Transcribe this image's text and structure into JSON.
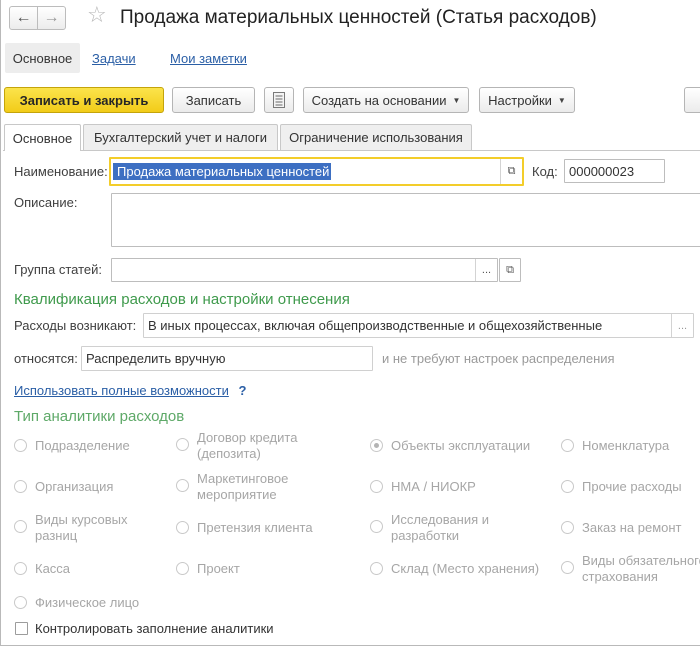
{
  "window": {
    "title": "Продажа материальных ценностей (Статья расходов)"
  },
  "nav": {
    "back_icon": "arrow-left-icon",
    "forward_icon": "arrow-right-icon",
    "favorite_icon": "star-icon",
    "tabs": [
      {
        "label": "Основное",
        "active": true
      },
      {
        "label": "Задачи"
      },
      {
        "label": "Мои заметки"
      }
    ]
  },
  "toolbar": {
    "save_close": "Записать и закрыть",
    "save": "Записать",
    "report_icon": "document-list-icon",
    "create_based": "Создать на основании",
    "settings": "Настройки"
  },
  "content_tabs": [
    {
      "label": "Основное",
      "active": true
    },
    {
      "label": "Бухгалтерский учет и налоги"
    },
    {
      "label": "Ограничение использования"
    }
  ],
  "form": {
    "name_label": "Наименование:",
    "name_value": "Продажа материальных ценностей",
    "code_label": "Код:",
    "code_value": "000000023",
    "description_label": "Описание:",
    "description_value": "",
    "group_label": "Группа статей:",
    "group_value": "",
    "select_button": "...",
    "open_icon": "open-form-icon"
  },
  "qualification": {
    "heading": "Квалификация расходов и настройки отнесения",
    "expenses_arise_label": "Расходы возникают:",
    "expenses_arise_value": "В иных процессах, включая общепроизводственные и общехозяйственные",
    "relates_label": "относятся:",
    "relates_value": "Распределить вручную",
    "relates_hint": "и не требуют настроек распределения",
    "full_features_link": "Использовать полные возможности",
    "help": "?"
  },
  "analytics": {
    "heading": "Тип аналитики расходов",
    "options": [
      {
        "label": "Подразделение",
        "selected": false
      },
      {
        "label": "Договор кредита (депозита)",
        "selected": false
      },
      {
        "label": "Объекты эксплуатации",
        "selected": true
      },
      {
        "label": "Номенклатура",
        "selected": false
      },
      {
        "label": "Организация",
        "selected": false
      },
      {
        "label": "Маркетинговое мероприятие",
        "selected": false
      },
      {
        "label": "НМА / НИОКР",
        "selected": false
      },
      {
        "label": "Прочие расходы",
        "selected": false
      },
      {
        "label": "Виды курсовых разниц",
        "selected": false
      },
      {
        "label": "Претензия клиента",
        "selected": false
      },
      {
        "label": "Исследования и разработки",
        "selected": false
      },
      {
        "label": "Заказ на ремонт",
        "selected": false
      },
      {
        "label": "Касса",
        "selected": false
      },
      {
        "label": "Проект",
        "selected": false
      },
      {
        "label": "Склад (Место хранения)",
        "selected": false
      },
      {
        "label": "Виды обязательного страхования",
        "selected": false
      },
      {
        "label": "Физическое лицо",
        "selected": false
      }
    ],
    "control_checkbox_label": "Контролировать заполнение аналитики",
    "control_checked": false
  }
}
